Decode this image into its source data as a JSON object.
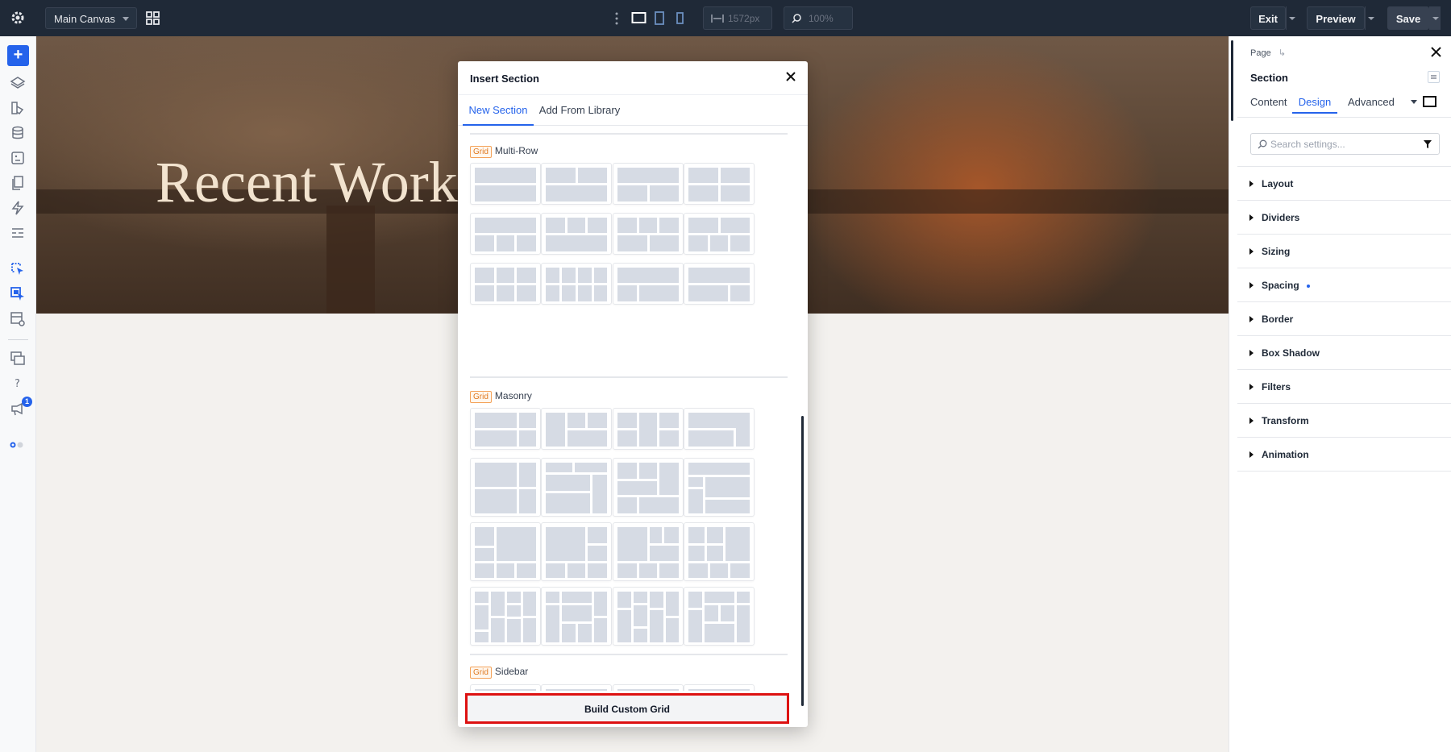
{
  "topbar": {
    "canvas_select": "Main Canvas",
    "width_value": "1572px",
    "zoom_value": "100%",
    "exit_label": "Exit",
    "preview_label": "Preview",
    "save_label": "Save"
  },
  "hero": {
    "title": "Recent Work"
  },
  "modal": {
    "title": "Insert Section",
    "tabs": [
      "New Section",
      "Add From Library"
    ],
    "active_tab": "New Section",
    "sections": [
      {
        "tag": "Grid",
        "name": "Multi-Row",
        "tile_count": 12
      },
      {
        "tag": "Grid",
        "name": "Masonry",
        "tile_count": 16
      },
      {
        "tag": "Grid",
        "name": "Sidebar",
        "tile_count": 4
      }
    ],
    "build_button": "Build Custom Grid"
  },
  "panel": {
    "breadcrumb": "Page",
    "title": "Section",
    "tabs": [
      "Content",
      "Design",
      "Advanced"
    ],
    "active_tab": "Design",
    "search_placeholder": "Search settings...",
    "groups": [
      {
        "label": "Layout",
        "modified": false
      },
      {
        "label": "Dividers",
        "modified": false
      },
      {
        "label": "Sizing",
        "modified": false
      },
      {
        "label": "Spacing",
        "modified": true
      },
      {
        "label": "Border",
        "modified": false
      },
      {
        "label": "Box Shadow",
        "modified": false
      },
      {
        "label": "Filters",
        "modified": false
      },
      {
        "label": "Transform",
        "modified": false
      },
      {
        "label": "Animation",
        "modified": false
      }
    ]
  },
  "rail": {
    "notification_count": "1"
  },
  "colors": {
    "accent": "#2563eb",
    "topbar": "#1f2937",
    "grid_tag": "#e07b24",
    "highlight": "#dd1111"
  }
}
